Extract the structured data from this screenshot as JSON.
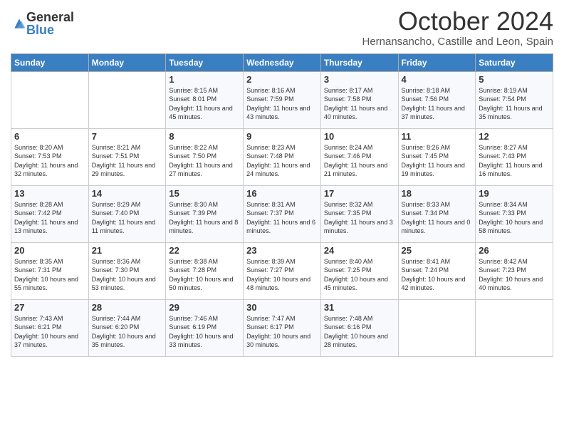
{
  "logo": {
    "general": "General",
    "blue": "Blue"
  },
  "title": "October 2024",
  "location": "Hernansancho, Castille and Leon, Spain",
  "days_of_week": [
    "Sunday",
    "Monday",
    "Tuesday",
    "Wednesday",
    "Thursday",
    "Friday",
    "Saturday"
  ],
  "weeks": [
    [
      {
        "day": null,
        "info": null
      },
      {
        "day": null,
        "info": null
      },
      {
        "day": "1",
        "info": "Sunrise: 8:15 AM\nSunset: 8:01 PM\nDaylight: 11 hours and 45 minutes."
      },
      {
        "day": "2",
        "info": "Sunrise: 8:16 AM\nSunset: 7:59 PM\nDaylight: 11 hours and 43 minutes."
      },
      {
        "day": "3",
        "info": "Sunrise: 8:17 AM\nSunset: 7:58 PM\nDaylight: 11 hours and 40 minutes."
      },
      {
        "day": "4",
        "info": "Sunrise: 8:18 AM\nSunset: 7:56 PM\nDaylight: 11 hours and 37 minutes."
      },
      {
        "day": "5",
        "info": "Sunrise: 8:19 AM\nSunset: 7:54 PM\nDaylight: 11 hours and 35 minutes."
      }
    ],
    [
      {
        "day": "6",
        "info": "Sunrise: 8:20 AM\nSunset: 7:53 PM\nDaylight: 11 hours and 32 minutes."
      },
      {
        "day": "7",
        "info": "Sunrise: 8:21 AM\nSunset: 7:51 PM\nDaylight: 11 hours and 29 minutes."
      },
      {
        "day": "8",
        "info": "Sunrise: 8:22 AM\nSunset: 7:50 PM\nDaylight: 11 hours and 27 minutes."
      },
      {
        "day": "9",
        "info": "Sunrise: 8:23 AM\nSunset: 7:48 PM\nDaylight: 11 hours and 24 minutes."
      },
      {
        "day": "10",
        "info": "Sunrise: 8:24 AM\nSunset: 7:46 PM\nDaylight: 11 hours and 21 minutes."
      },
      {
        "day": "11",
        "info": "Sunrise: 8:26 AM\nSunset: 7:45 PM\nDaylight: 11 hours and 19 minutes."
      },
      {
        "day": "12",
        "info": "Sunrise: 8:27 AM\nSunset: 7:43 PM\nDaylight: 11 hours and 16 minutes."
      }
    ],
    [
      {
        "day": "13",
        "info": "Sunrise: 8:28 AM\nSunset: 7:42 PM\nDaylight: 11 hours and 13 minutes."
      },
      {
        "day": "14",
        "info": "Sunrise: 8:29 AM\nSunset: 7:40 PM\nDaylight: 11 hours and 11 minutes."
      },
      {
        "day": "15",
        "info": "Sunrise: 8:30 AM\nSunset: 7:39 PM\nDaylight: 11 hours and 8 minutes."
      },
      {
        "day": "16",
        "info": "Sunrise: 8:31 AM\nSunset: 7:37 PM\nDaylight: 11 hours and 6 minutes."
      },
      {
        "day": "17",
        "info": "Sunrise: 8:32 AM\nSunset: 7:35 PM\nDaylight: 11 hours and 3 minutes."
      },
      {
        "day": "18",
        "info": "Sunrise: 8:33 AM\nSunset: 7:34 PM\nDaylight: 11 hours and 0 minutes."
      },
      {
        "day": "19",
        "info": "Sunrise: 8:34 AM\nSunset: 7:33 PM\nDaylight: 10 hours and 58 minutes."
      }
    ],
    [
      {
        "day": "20",
        "info": "Sunrise: 8:35 AM\nSunset: 7:31 PM\nDaylight: 10 hours and 55 minutes."
      },
      {
        "day": "21",
        "info": "Sunrise: 8:36 AM\nSunset: 7:30 PM\nDaylight: 10 hours and 53 minutes."
      },
      {
        "day": "22",
        "info": "Sunrise: 8:38 AM\nSunset: 7:28 PM\nDaylight: 10 hours and 50 minutes."
      },
      {
        "day": "23",
        "info": "Sunrise: 8:39 AM\nSunset: 7:27 PM\nDaylight: 10 hours and 48 minutes."
      },
      {
        "day": "24",
        "info": "Sunrise: 8:40 AM\nSunset: 7:25 PM\nDaylight: 10 hours and 45 minutes."
      },
      {
        "day": "25",
        "info": "Sunrise: 8:41 AM\nSunset: 7:24 PM\nDaylight: 10 hours and 42 minutes."
      },
      {
        "day": "26",
        "info": "Sunrise: 8:42 AM\nSunset: 7:23 PM\nDaylight: 10 hours and 40 minutes."
      }
    ],
    [
      {
        "day": "27",
        "info": "Sunrise: 7:43 AM\nSunset: 6:21 PM\nDaylight: 10 hours and 37 minutes."
      },
      {
        "day": "28",
        "info": "Sunrise: 7:44 AM\nSunset: 6:20 PM\nDaylight: 10 hours and 35 minutes."
      },
      {
        "day": "29",
        "info": "Sunrise: 7:46 AM\nSunset: 6:19 PM\nDaylight: 10 hours and 33 minutes."
      },
      {
        "day": "30",
        "info": "Sunrise: 7:47 AM\nSunset: 6:17 PM\nDaylight: 10 hours and 30 minutes."
      },
      {
        "day": "31",
        "info": "Sunrise: 7:48 AM\nSunset: 6:16 PM\nDaylight: 10 hours and 28 minutes."
      },
      {
        "day": null,
        "info": null
      },
      {
        "day": null,
        "info": null
      }
    ]
  ]
}
